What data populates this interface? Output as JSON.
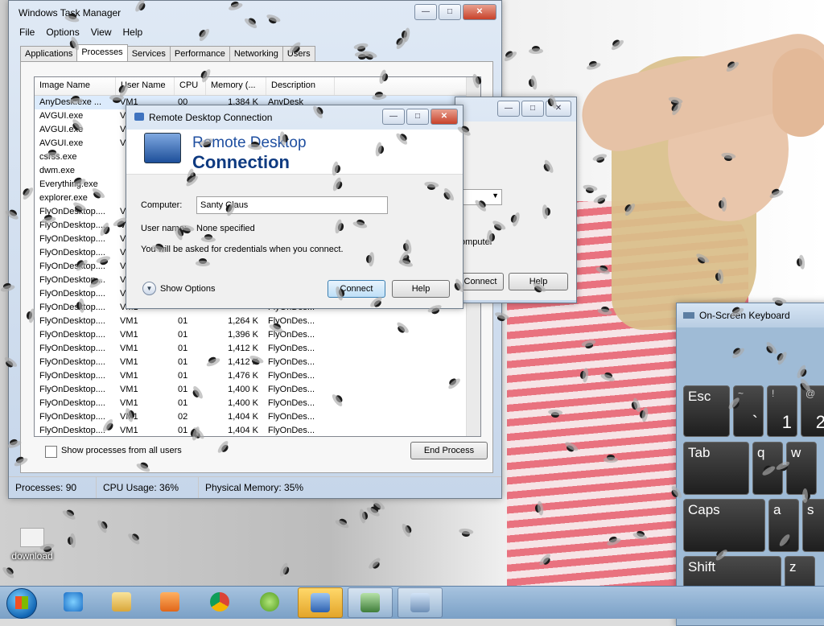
{
  "task_manager": {
    "title": "Windows Task Manager",
    "menu": [
      "File",
      "Options",
      "View",
      "Help"
    ],
    "tabs": [
      "Applications",
      "Processes",
      "Services",
      "Performance",
      "Networking",
      "Users"
    ],
    "active_tab": "Processes",
    "columns": [
      "Image Name",
      "User Name",
      "CPU",
      "Memory (...",
      "Description"
    ],
    "rows": [
      [
        "AnyDesk.exe ...",
        "VM1",
        "00",
        "1,384 K",
        "AnyDesk"
      ],
      [
        "AVGUI.exe",
        "VM1",
        "",
        "",
        ""
      ],
      [
        "AVGUI.exe",
        "VM1",
        "",
        "",
        ""
      ],
      [
        "AVGUI.exe",
        "VM1",
        "",
        "",
        ""
      ],
      [
        "csrss.exe",
        "",
        "",
        "",
        ""
      ],
      [
        "dwm.exe",
        "",
        "",
        "",
        ""
      ],
      [
        "Everything.exe",
        "",
        "",
        "",
        ""
      ],
      [
        "explorer.exe",
        "",
        "",
        "",
        ""
      ],
      [
        "FlyOnDesktop....",
        "VM1",
        "",
        "",
        ""
      ],
      [
        "FlyOnDesktop....",
        "VM1",
        "",
        "",
        ""
      ],
      [
        "FlyOnDesktop....",
        "VM1",
        "",
        "",
        ""
      ],
      [
        "FlyOnDesktop....",
        "VM1",
        "",
        "",
        ""
      ],
      [
        "FlyOnDesktop....",
        "VM1",
        "",
        "",
        ""
      ],
      [
        "FlyOnDesktop....",
        "VM1",
        "",
        "",
        ""
      ],
      [
        "FlyOnDesktop....",
        "VM1",
        "",
        "",
        ""
      ],
      [
        "FlyOnDesktop....",
        "VM1",
        "",
        "",
        "FlyOnDes..."
      ],
      [
        "FlyOnDesktop....",
        "VM1",
        "01",
        "1,264 K",
        "FlyOnDes..."
      ],
      [
        "FlyOnDesktop....",
        "VM1",
        "01",
        "1,396 K",
        "FlyOnDes..."
      ],
      [
        "FlyOnDesktop....",
        "VM1",
        "01",
        "1,412 K",
        "FlyOnDes..."
      ],
      [
        "FlyOnDesktop....",
        "VM1",
        "01",
        "1,412 K",
        "FlyOnDes..."
      ],
      [
        "FlyOnDesktop....",
        "VM1",
        "01",
        "1,476 K",
        "FlyOnDes..."
      ],
      [
        "FlyOnDesktop....",
        "VM1",
        "01",
        "1,400 K",
        "FlyOnDes..."
      ],
      [
        "FlyOnDesktop....",
        "VM1",
        "01",
        "1,400 K",
        "FlyOnDes..."
      ],
      [
        "FlyOnDesktop....",
        "VM1",
        "02",
        "1,404 K",
        "FlyOnDes..."
      ],
      [
        "FlyOnDesktop....",
        "VM1",
        "01",
        "1,404 K",
        "FlyOnDes..."
      ]
    ],
    "show_all_label": "Show processes from all users",
    "end_process_label": "End Process",
    "status": {
      "processes": "Processes: 90",
      "cpu": "CPU Usage: 36%",
      "memory": "Physical Memory: 35%"
    }
  },
  "rdc": {
    "title": "Remote Desktop Connection",
    "banner_line1": "Remote Desktop",
    "banner_line2": "Connection",
    "computer_label": "Computer:",
    "computer_value": "Santy Claus",
    "username_label": "User name:",
    "username_value": "None specified",
    "info": "You will be asked for credentials when you connect.",
    "show_options": "Show Options",
    "connect_label": "Connect",
    "help_label": "Help"
  },
  "rdc_back": {
    "connect_label": "Connect",
    "help_label": "Help",
    "text_fragment": "omputer"
  },
  "osk": {
    "title": "On-Screen Keyboard",
    "keys": {
      "esc": "Esc",
      "tilde_top": "~",
      "tilde_bottom": "`",
      "excl_top": "!",
      "one": "1",
      "at_top": "@",
      "two": "2",
      "tab": "Tab",
      "q": "q",
      "w": "w",
      "caps": "Caps",
      "a": "a",
      "s": "s",
      "shift": "Shift",
      "z": "z"
    }
  },
  "desktop": {
    "icon_label": "download"
  },
  "taskbar": {
    "items": [
      "internet-explorer",
      "file-explorer",
      "media-player",
      "chrome",
      "utorrent",
      "remote-desktop",
      "task-manager",
      "on-screen-keyboard"
    ],
    "active_item": "remote-desktop"
  },
  "colors": {
    "accent": "#1f4fa0",
    "taskbar": "#8fb0d2",
    "close_button": "#c7412a"
  }
}
